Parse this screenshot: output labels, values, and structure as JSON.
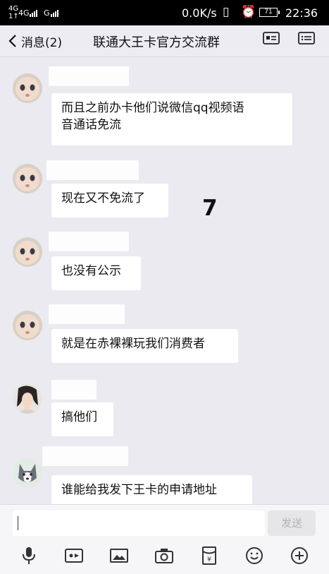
{
  "status_bar": {
    "network_top": "4G",
    "network_bottom": "1↑",
    "carrier1": "4G",
    "carrier2": "G",
    "speed": "0.0K/s",
    "battery": "71",
    "time": "22:36"
  },
  "nav": {
    "back_label": "消息(2)",
    "title": "联通大王卡官方交流群"
  },
  "messages": [
    {
      "avatar": "baby-face",
      "text_line1": "而且之前办卡他们说微信qq视频语",
      "text_line2": "音通话免流"
    },
    {
      "avatar": "baby-face",
      "text": "现在又不免流了"
    },
    {
      "avatar": "baby-face",
      "text": "也没有公示"
    },
    {
      "avatar": "baby-face",
      "text": "就是在赤裸裸玩我们消费者"
    },
    {
      "avatar": "woman-photo",
      "text": "搞他们"
    },
    {
      "avatar": "husky-dog",
      "text": "谁能给我发下王卡的申请地址"
    }
  ],
  "overlay_number": "7",
  "composer": {
    "send_label": "发送",
    "placeholder": ""
  },
  "toolbar_icons": [
    "microphone-icon",
    "video-call-icon",
    "image-icon",
    "camera-icon",
    "red-packet-icon",
    "emoji-icon",
    "plus-icon"
  ],
  "colors": {
    "background": "#eaeaf0",
    "bubble": "#ffffff",
    "status_bar": "#000000"
  }
}
